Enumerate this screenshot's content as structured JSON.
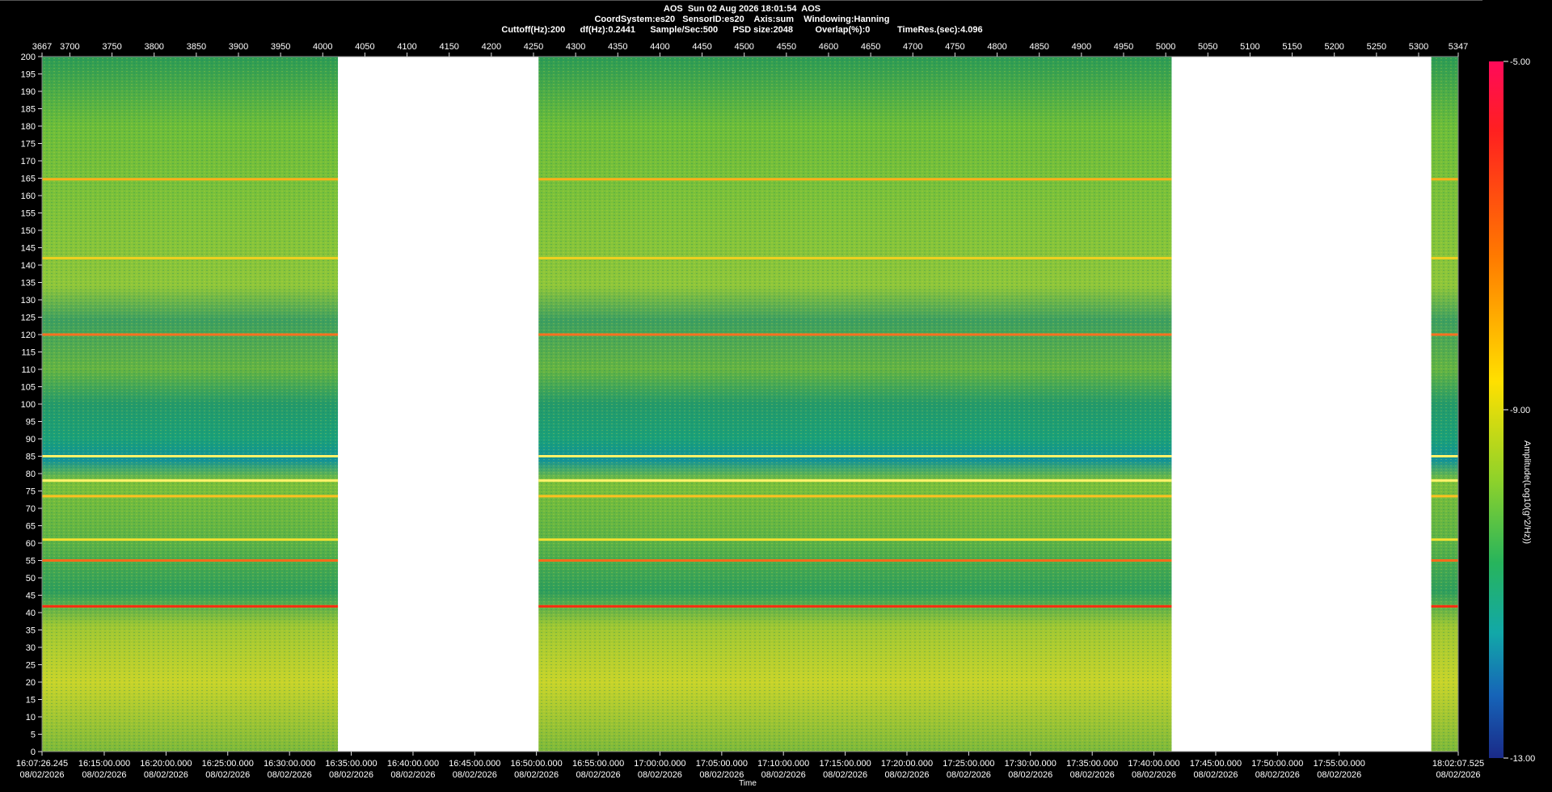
{
  "header": {
    "title": "AOS  Sun 02 Aug 2026 18:01:54  AOS",
    "line2": "CoordSystem:es20   SensorID:es20    Axis:sum    Windowing:Hanning",
    "line3": "Cuttoff(Hz):200      df(Hz):0.2441      Sample/Sec:500      PSD size:2048         Overlap(%):0           TimeRes.(sec):4.096"
  },
  "chart_data": {
    "type": "heatmap",
    "ylim": [
      0,
      200
    ],
    "y_ticks": [
      0,
      5,
      10,
      15,
      20,
      25,
      30,
      35,
      40,
      45,
      50,
      55,
      60,
      65,
      70,
      75,
      80,
      85,
      90,
      95,
      100,
      105,
      110,
      115,
      120,
      125,
      130,
      135,
      140,
      145,
      150,
      155,
      160,
      165,
      170,
      175,
      180,
      185,
      190,
      195,
      200
    ],
    "top_axis": {
      "range": [
        3667,
        5347
      ],
      "ticks": [
        "3667",
        "3700",
        "3750",
        "3800",
        "3850",
        "3900",
        "3950",
        "4000",
        "4050",
        "4100",
        "4150",
        "4200",
        "4250",
        "4300",
        "4350",
        "4400",
        "4450",
        "4500",
        "4550",
        "4600",
        "4650",
        "4700",
        "4750",
        "4800",
        "4850",
        "4900",
        "4950",
        "5000",
        "5050",
        "5100",
        "5150",
        "5200",
        "5250",
        "5300",
        "5347"
      ]
    },
    "x_ticks": [
      {
        "index": 3667,
        "time": "16:07:26.245",
        "date": "08/02/2026"
      },
      {
        "index": 3740.8,
        "time": "16:15:00.000",
        "date": "08/02/2026"
      },
      {
        "index": 3814.1,
        "time": "16:20:00.000",
        "date": "08/02/2026"
      },
      {
        "index": 3887.3,
        "time": "16:25:00.000",
        "date": "08/02/2026"
      },
      {
        "index": 3960.6,
        "time": "16:30:00.000",
        "date": "08/02/2026"
      },
      {
        "index": 4033.8,
        "time": "16:35:00.000",
        "date": "08/02/2026"
      },
      {
        "index": 4107.1,
        "time": "16:40:00.000",
        "date": "08/02/2026"
      },
      {
        "index": 4180.3,
        "time": "16:45:00.000",
        "date": "08/02/2026"
      },
      {
        "index": 4253.5,
        "time": "16:50:00.000",
        "date": "08/02/2026"
      },
      {
        "index": 4326.8,
        "time": "16:55:00.000",
        "date": "08/02/2026"
      },
      {
        "index": 4400,
        "time": "17:00:00.000",
        "date": "08/02/2026"
      },
      {
        "index": 4473.3,
        "time": "17:05:00.000",
        "date": "08/02/2026"
      },
      {
        "index": 4546.5,
        "time": "17:10:00.000",
        "date": "08/02/2026"
      },
      {
        "index": 4619.8,
        "time": "17:15:00.000",
        "date": "08/02/2026"
      },
      {
        "index": 4693,
        "time": "17:20:00.000",
        "date": "08/02/2026"
      },
      {
        "index": 4766.3,
        "time": "17:25:00.000",
        "date": "08/02/2026"
      },
      {
        "index": 4839.5,
        "time": "17:30:00.000",
        "date": "08/02/2026"
      },
      {
        "index": 4912.8,
        "time": "17:35:00.000",
        "date": "08/02/2026"
      },
      {
        "index": 4986,
        "time": "17:40:00.000",
        "date": "08/02/2026"
      },
      {
        "index": 5059.3,
        "time": "17:45:00.000",
        "date": "08/02/2026"
      },
      {
        "index": 5132.5,
        "time": "17:50:00.000",
        "date": "08/02/2026"
      },
      {
        "index": 5205.8,
        "time": "17:55:00.000",
        "date": "08/02/2026"
      },
      {
        "index": 5347,
        "time": "18:02:07.525",
        "date": "08/02/2026"
      }
    ],
    "xlabel": "Time",
    "data_segments": [
      [
        3667,
        4018
      ],
      [
        4256,
        5007
      ],
      [
        5315,
        5347
      ]
    ],
    "narrowband_lines_hz": [
      {
        "hz": 164.7,
        "color": "#ffb01a"
      },
      {
        "hz": 142,
        "color": "#f0d020"
      },
      {
        "hz": 120,
        "color": "#ff7020"
      },
      {
        "hz": 85,
        "color": "#fff26a"
      },
      {
        "hz": 78,
        "color": "#fff26a"
      },
      {
        "hz": 73.5,
        "color": "#ffc020"
      },
      {
        "hz": 61,
        "color": "#f5e030"
      },
      {
        "hz": 55,
        "color": "#ff6a1a"
      },
      {
        "hz": 41.8,
        "color": "#ff2a10"
      }
    ],
    "colorbar": {
      "max": -5.0,
      "mid": -9.0,
      "min": -13.0,
      "ticks": [
        "-5.00",
        "-9.00",
        "-13.00"
      ],
      "label": "Amplitude(Log10(g^2/Hz))",
      "colors": [
        "#ff0a5a",
        "#ff2020",
        "#ff7a00",
        "#ffe000",
        "#8fd22a",
        "#27b45c",
        "#12a8a8",
        "#1664b8",
        "#1a2a88"
      ]
    }
  }
}
